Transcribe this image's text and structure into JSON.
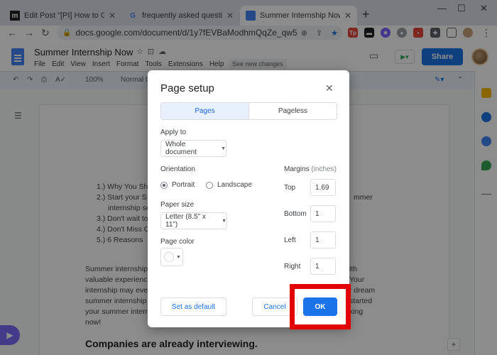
{
  "browser": {
    "tabs": [
      {
        "title": "Edit Post \"[PI] How to Change",
        "favicon": "m"
      },
      {
        "title": "frequently asked questions ab",
        "favicon": "G"
      },
      {
        "title": "Summer Internship Now - Goo",
        "favicon": "docs"
      }
    ],
    "url": "docs.google.com/document/d/1y7fEVBaModhmQqZe_qw55Mik..."
  },
  "docs": {
    "title": "Summer Internship Now",
    "menus": [
      "File",
      "Edit",
      "View",
      "Insert",
      "Format",
      "Tools",
      "Extensions",
      "Help"
    ],
    "new_changes": "See new changes",
    "share_label": "Share",
    "zoom": "100%",
    "style": "Normal te"
  },
  "document": {
    "list_items": [
      "1.) Why You Sh",
      "2.) Start your S",
      "internship se",
      "3.) Don't wait to",
      "4.) Don't Miss C",
      "5.)  6 Reasons"
    ],
    "right_fragments": [
      "mmer"
    ],
    "paragraph_left": [
      "Summer internship",
      "valuable experienc",
      "internship may eve",
      "summer internship",
      "your summer intern",
      "now!"
    ],
    "paragraph_right": [
      "ith",
      "Your",
      "r dream",
      "started",
      "king"
    ],
    "heading": "Companies are already interviewing."
  },
  "dialog": {
    "title": "Page setup",
    "tabs": [
      "Pages",
      "Pageless"
    ],
    "apply_to_label": "Apply to",
    "apply_to_value": "Whole document",
    "orientation_label": "Orientation",
    "portrait": "Portrait",
    "landscape": "Landscape",
    "paper_size_label": "Paper size",
    "paper_size_value": "Letter (8.5\" x 11\")",
    "page_color_label": "Page color",
    "margins_label": "Margins",
    "margins_unit": "(inches)",
    "margins": {
      "top_label": "Top",
      "top": "1.69",
      "bottom_label": "Bottom",
      "bottom": "1",
      "left_label": "Left",
      "left": "1",
      "right_label": "Right",
      "right": "1"
    },
    "set_default": "Set as default",
    "cancel": "Cancel",
    "ok": "OK"
  },
  "colors": {
    "accent": "#1a73e8",
    "highlight": "#e30000"
  }
}
